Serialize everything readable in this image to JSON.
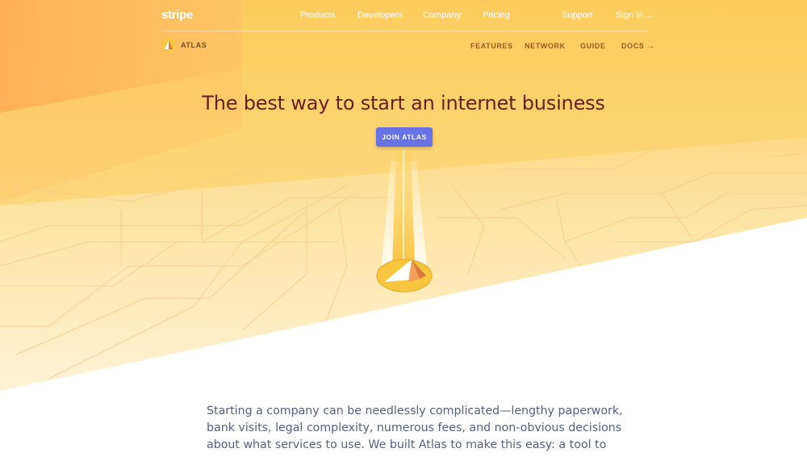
{
  "brand": {
    "name": "stripe"
  },
  "nav": {
    "products": "Products",
    "developers": "Developers",
    "company": "Company",
    "pricing": "Pricing",
    "support": "Support",
    "signin": "Sign in"
  },
  "subnav": {
    "product_name": "ATLAS",
    "features": "FEATURES",
    "network": "NETWORK",
    "guide": "GUIDE",
    "docs": "DOCS"
  },
  "hero": {
    "headline": "The best way to start an internet business",
    "cta": "JOIN ATLAS"
  },
  "intro": {
    "lines": [
      "Starting a company can be needlessly complicated—lengthy paperwork,",
      "bank visits, legal complexity, numerous fees, and non-obvious decisions",
      "about what services to use. We built Atlas to make this easy: a tool to"
    ]
  },
  "colors": {
    "accent": "#6772e5",
    "headline": "#6b1d1d",
    "body_text": "#525f7f",
    "hero_orange": "#ffb45a",
    "hero_yellow": "#fcd26a"
  },
  "icons": {
    "atlas_logo": "atlas-triangle-icon",
    "arrow": "arrow-right-icon",
    "map_marker": "map-marker-icon"
  }
}
